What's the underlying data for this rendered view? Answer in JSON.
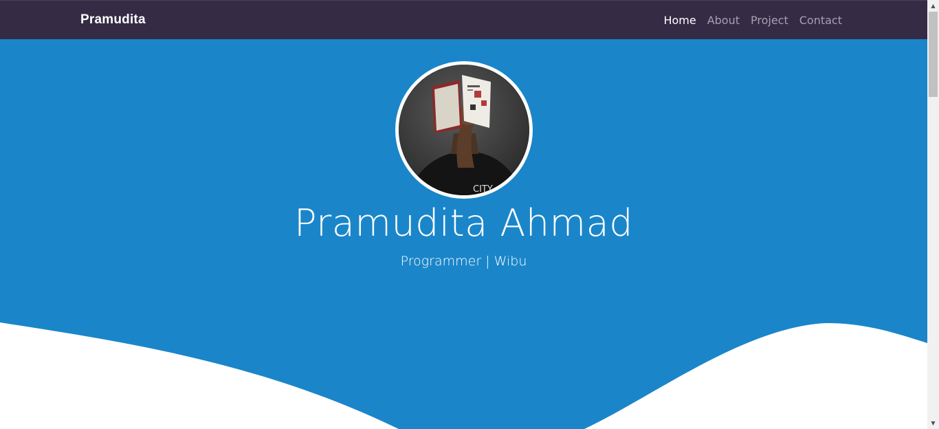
{
  "navbar": {
    "brand": "Pramudita",
    "links": [
      {
        "label": "Home",
        "active": true
      },
      {
        "label": "About",
        "active": false
      },
      {
        "label": "Project",
        "active": false
      },
      {
        "label": "Contact",
        "active": false
      }
    ]
  },
  "hero": {
    "name": "Pramudita Ahmad",
    "tagline": "Programmer | Wibu",
    "avatar_shirt_text": "CITY"
  },
  "colors": {
    "navbar_bg": "#352b45",
    "hero_bg": "#1a86c9",
    "wave_fill": "#ffffff"
  },
  "scrollbar": {
    "up_arrow": "▲",
    "down_arrow": "▼"
  }
}
